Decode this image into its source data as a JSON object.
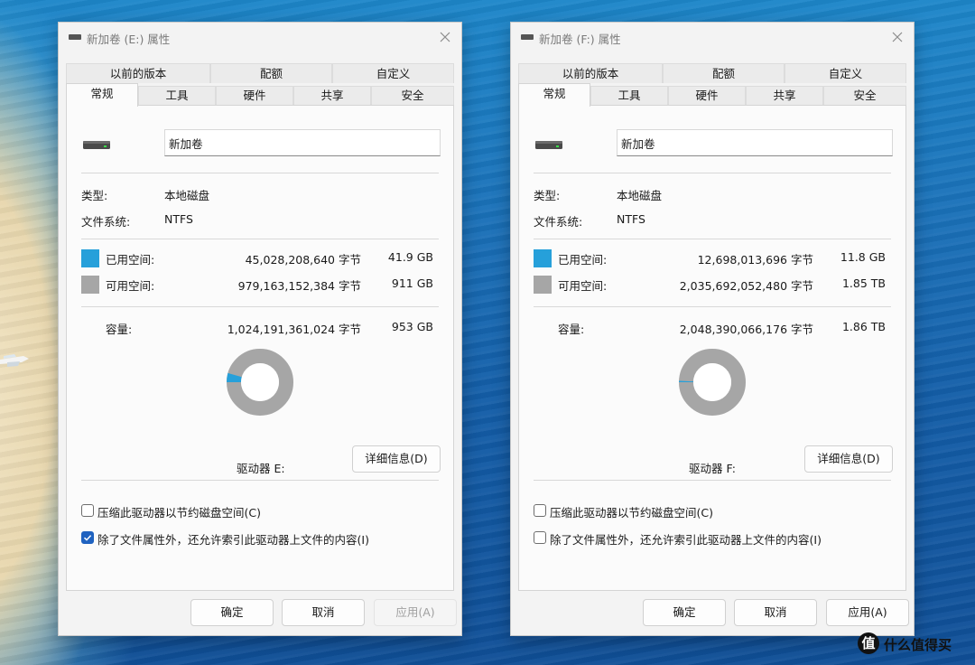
{
  "colors": {
    "used": "#26a0da",
    "free": "#a6a6a6",
    "accent": "#1f62c0"
  },
  "dialogs": [
    {
      "title": "新加卷 (E:) 属性",
      "tabs_top": [
        "以前的版本",
        "配额",
        "自定义"
      ],
      "tabs_bottom": [
        "常规",
        "工具",
        "硬件",
        "共享",
        "安全"
      ],
      "active_tab": "常规",
      "volume_name": "新加卷",
      "type_label": "类型:",
      "type_value": "本地磁盘",
      "fs_label": "文件系统:",
      "fs_value": "NTFS",
      "used_label": "已用空间:",
      "used_bytes": "45,028,208,640 字节",
      "used_size": "41.9 GB",
      "free_label": "可用空间:",
      "free_bytes": "979,163,152,384 字节",
      "free_size": "911 GB",
      "capacity_label": "容量:",
      "capacity_bytes": "1,024,191,361,024 字节",
      "capacity_size": "953 GB",
      "used_fraction": 0.044,
      "drive_label": "驱动器 E:",
      "details_button": "详细信息(D)",
      "compress_label": "压缩此驱动器以节约磁盘空间(C)",
      "compress_checked": false,
      "index_label": "除了文件属性外，还允许索引此驱动器上文件的内容(I)",
      "index_checked": true,
      "ok_button": "确定",
      "cancel_button": "取消",
      "apply_button": "应用(A)",
      "apply_enabled": false
    },
    {
      "title": "新加卷 (F:) 属性",
      "tabs_top": [
        "以前的版本",
        "配额",
        "自定义"
      ],
      "tabs_bottom": [
        "常规",
        "工具",
        "硬件",
        "共享",
        "安全"
      ],
      "active_tab": "常规",
      "volume_name": "新加卷",
      "type_label": "类型:",
      "type_value": "本地磁盘",
      "fs_label": "文件系统:",
      "fs_value": "NTFS",
      "used_label": "已用空间:",
      "used_bytes": "12,698,013,696 字节",
      "used_size": "11.8 GB",
      "free_label": "可用空间:",
      "free_bytes": "2,035,692,052,480 字节",
      "free_size": "1.85 TB",
      "capacity_label": "容量:",
      "capacity_bytes": "2,048,390,066,176 字节",
      "capacity_size": "1.86 TB",
      "used_fraction": 0.0062,
      "drive_label": "驱动器 F:",
      "details_button": "详细信息(D)",
      "compress_label": "压缩此驱动器以节约磁盘空间(C)",
      "compress_checked": false,
      "index_label": "除了文件属性外，还允许索引此驱动器上文件的内容(I)",
      "index_checked": false,
      "ok_button": "确定",
      "cancel_button": "取消",
      "apply_button": "应用(A)",
      "apply_enabled": true
    }
  ],
  "watermark": {
    "logo_char": "值",
    "text": "什么值得买"
  }
}
